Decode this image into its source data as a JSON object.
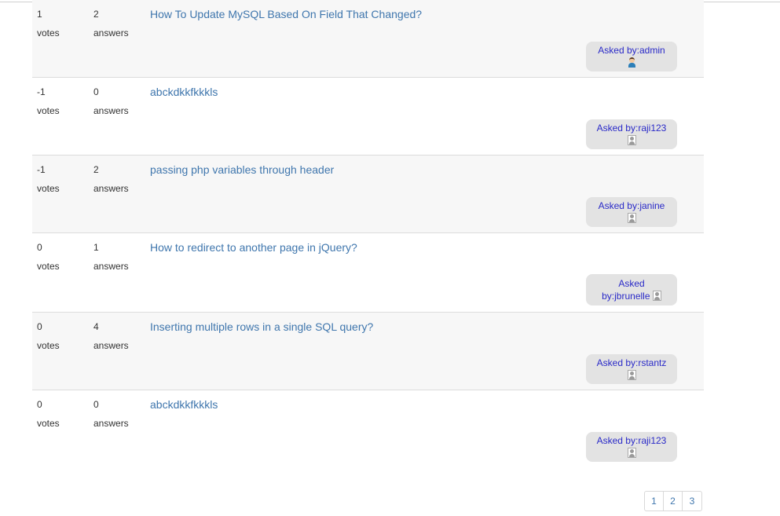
{
  "questions": [
    {
      "votes": "1",
      "votes_label": "votes",
      "answers": "2",
      "answers_label": "answers",
      "title": "How To Update MySQL Based On Field That Changed?",
      "asked_prefix": "Asked by:",
      "asked_by": "admin",
      "avatar_icon": "user-avatar-icon"
    },
    {
      "votes": "-1",
      "votes_label": "votes",
      "answers": "0",
      "answers_label": "answers",
      "title": "abckdkkfkkkls",
      "asked_prefix": "Asked by:",
      "asked_by": "raji123",
      "avatar_icon": "default-avatar-icon"
    },
    {
      "votes": "-1",
      "votes_label": "votes",
      "answers": "2",
      "answers_label": "answers",
      "title": "passing php variables through header",
      "asked_prefix": "Asked by:",
      "asked_by": "janine",
      "avatar_icon": "default-avatar-icon"
    },
    {
      "votes": "0",
      "votes_label": "votes",
      "answers": "1",
      "answers_label": "answers",
      "title": "How to redirect to another page in jQuery?",
      "asked_prefix": "Asked",
      "asked_prefix_2": "by:",
      "asked_by": "jbrunelle",
      "avatar_icon": "default-avatar-icon"
    },
    {
      "votes": "0",
      "votes_label": "votes",
      "answers": "4",
      "answers_label": "answers",
      "title": "Inserting multiple rows in a single SQL query?",
      "asked_prefix": "Asked by:",
      "asked_by": "rstantz",
      "avatar_icon": "default-avatar-icon"
    },
    {
      "votes": "0",
      "votes_label": "votes",
      "answers": "0",
      "answers_label": "answers",
      "title": "abckdkkfkkkls",
      "asked_prefix": "Asked by:",
      "asked_by": "raji123",
      "avatar_icon": "default-avatar-icon"
    }
  ],
  "pagination": {
    "pages": [
      "1",
      "2",
      "3"
    ]
  },
  "colors": {
    "link": "#3f76ad",
    "asked_text": "#2a2ac8",
    "badge_bg": "#e3e3e3",
    "alt_row_bg": "#f7f7f7"
  }
}
